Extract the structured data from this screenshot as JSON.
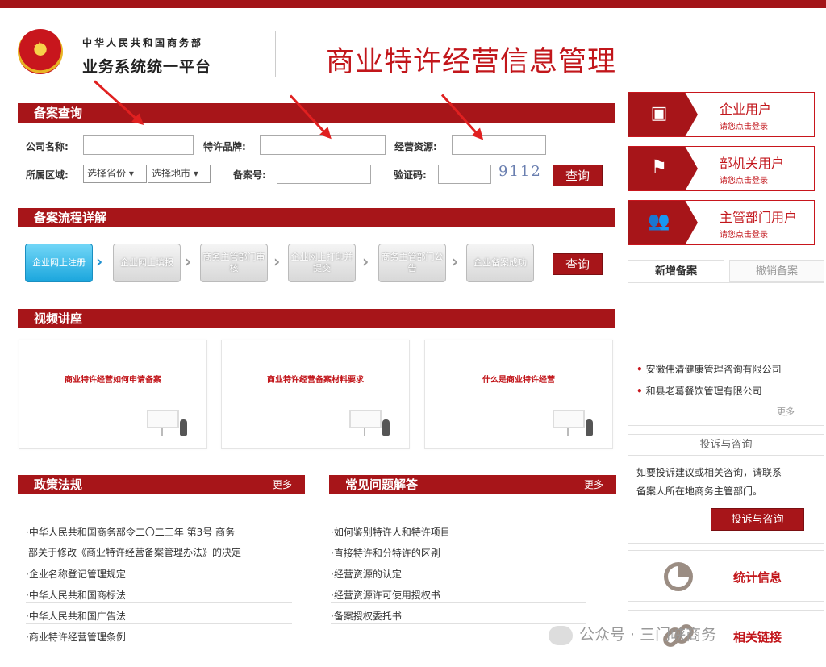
{
  "header": {
    "org_line1": "中华人民共和国商务部",
    "org_line2": "业务系统统一平台",
    "system_title": "商业特许经营信息管理"
  },
  "query": {
    "title": "备案查询",
    "company_label": "公司名称:",
    "brand_label": "特许品牌:",
    "resource_label": "经营资源:",
    "region_label": "所属区域:",
    "province_select": "选择省份",
    "city_select": "选择地市",
    "record_no_label": "备案号:",
    "captcha_label": "验证码:",
    "captcha_text": "9112",
    "search_button": "查询"
  },
  "process": {
    "title": "备案流程详解",
    "steps": [
      "企业网上注册",
      "企业网上填报",
      "商务主管部门审核",
      "企业网上打印并提交",
      "商务主管部门公告",
      "企业备案成功"
    ],
    "search_button": "查询"
  },
  "videos": {
    "title": "视频讲座",
    "items": [
      "商业特许经营如何申请备案",
      "商业特许经营备案材料要求",
      "什么是商业特许经营"
    ]
  },
  "policy": {
    "title": "政策法规",
    "more": "更多",
    "items": [
      "·中华人民共和国商务部令二〇二三年 第3号 商务",
      "部关于修改《商业特许经营备案管理办法》的决定",
      "·企业名称登记管理规定",
      "·中华人民共和国商标法",
      "·中华人民共和国广告法",
      "·商业特许经营管理条例"
    ]
  },
  "faq": {
    "title": "常见问题解答",
    "more": "更多",
    "items": [
      "·如何鉴别特许人和特许项目",
      "·直接特许和分特许的区别",
      "·经营资源的认定",
      "·经营资源许可使用授权书",
      "·备案授权委托书"
    ]
  },
  "users": [
    {
      "title": "企业用户",
      "subtitle": "请您点击登录",
      "icon": "id-card-icon"
    },
    {
      "title": "部机关用户",
      "subtitle": "请您点击登录",
      "icon": "flag-icon"
    },
    {
      "title": "主管部门用户",
      "subtitle": "请您点击登录",
      "icon": "users-icon"
    }
  ],
  "records": {
    "tab_new": "新增备案",
    "tab_cancel": "撤销备案",
    "items": [
      "安徽伟清健康管理咨询有限公司",
      "和县老葛餐饮管理有限公司"
    ],
    "more": "更多"
  },
  "complaint": {
    "title": "投诉与咨询",
    "text_line1": "如要投诉建议或相关咨询，请联系",
    "text_line2": "备案人所在地商务主管部门。",
    "button": "投诉与咨询"
  },
  "stats": {
    "title": "统计信息",
    "icon": "pie-chart-icon"
  },
  "links": {
    "title": "相关链接",
    "icon": "link-icon"
  },
  "watermark": {
    "text": "公众号 · 三门峡商务"
  },
  "colors": {
    "brand_red": "#a71519",
    "title_red": "#c2161b",
    "active_step": "#1ba6dd"
  }
}
